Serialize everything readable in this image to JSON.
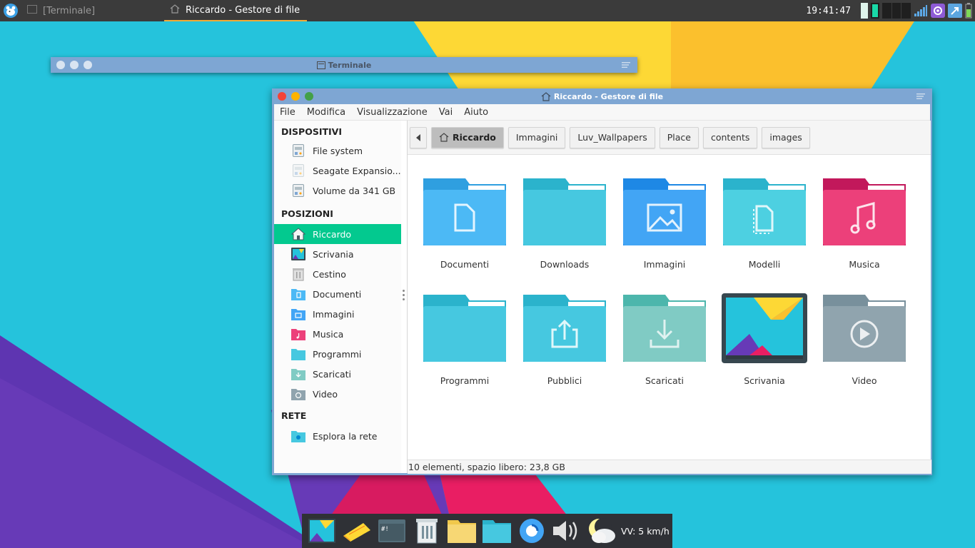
{
  "top_panel": {
    "tasks": [
      {
        "label": "[Terminale]",
        "state": "inactive"
      },
      {
        "label": "Riccardo - Gestore di file",
        "state": "active"
      }
    ],
    "clock": "19:41:47"
  },
  "terminal_window": {
    "title": "Terminale"
  },
  "file_manager": {
    "title": "Riccardo - Gestore di file",
    "menu": [
      "File",
      "Modifica",
      "Visualizzazione",
      "Vai",
      "Aiuto"
    ],
    "sidebar": {
      "devices_heading": "DISPOSITIVI",
      "devices": [
        "File system",
        "Seagate Expansio...",
        "Volume da 341 GB"
      ],
      "places_heading": "POSIZIONI",
      "places": [
        "Riccardo",
        "Scrivania",
        "Cestino",
        "Documenti",
        "Immagini",
        "Musica",
        "Programmi",
        "Scaricati",
        "Video"
      ],
      "selected_place": "Riccardo",
      "network_heading": "RETE",
      "network": [
        "Esplora la rete"
      ]
    },
    "path": [
      "Riccardo",
      "Immagini",
      "Luv_Wallpapers",
      "Place",
      "contents",
      "images"
    ],
    "items": [
      {
        "name": "Documenti",
        "icon": "folder-documents-icon",
        "color": "#4cb9f5"
      },
      {
        "name": "Downloads",
        "icon": "folder-icon",
        "color": "#46c8e0"
      },
      {
        "name": "Immagini",
        "icon": "folder-pictures-icon",
        "color": "#42a5f5"
      },
      {
        "name": "Modelli",
        "icon": "folder-templates-icon",
        "color": "#46c8e0"
      },
      {
        "name": "Musica",
        "icon": "folder-music-icon",
        "color": "#ec407a"
      },
      {
        "name": "Programmi",
        "icon": "folder-icon",
        "color": "#46c8e0"
      },
      {
        "name": "Pubblici",
        "icon": "folder-publicshare-icon",
        "color": "#46c8e0"
      },
      {
        "name": "Scaricati",
        "icon": "folder-download-icon",
        "color": "#80cbc4"
      },
      {
        "name": "Scrivania",
        "icon": "desktop-icon",
        "color": "#37474f"
      },
      {
        "name": "Video",
        "icon": "folder-videos-icon",
        "color": "#90a4ae"
      }
    ],
    "status": "10 elementi, spazio libero: 23,8 GB"
  },
  "dock": {
    "items": [
      "wallpaper-app-icon",
      "notes-icon",
      "terminal-icon",
      "archive-manager-icon",
      "folder-icon",
      "file-manager-icon",
      "web-browser-icon",
      "volume-icon",
      "weather-icon"
    ],
    "weather_text": "VV: 5 km/h"
  },
  "colors": {
    "selection": "#03c98f",
    "titlebar": "#7ea6d3",
    "active_task_underline": "#f2a935"
  }
}
